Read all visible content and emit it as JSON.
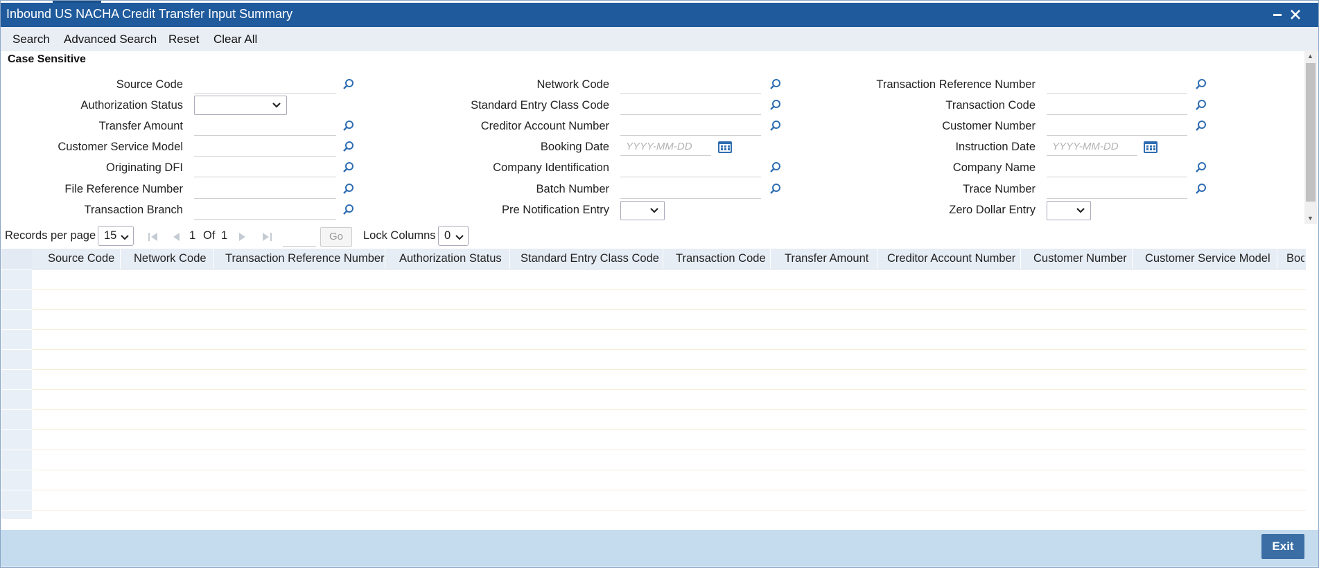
{
  "window": {
    "title": "Inbound US NACHA Credit Transfer Input Summary"
  },
  "menu": {
    "search": "Search",
    "advanced_search": "Advanced Search",
    "reset": "Reset",
    "clear_all": "Clear All"
  },
  "form": {
    "section_title": "Case Sensitive",
    "fields": {
      "source_code": "Source Code",
      "authorization_status": "Authorization Status",
      "transfer_amount": "Transfer Amount",
      "customer_service_model": "Customer Service Model",
      "originating_dfi": "Originating DFI",
      "file_reference_number": "File Reference Number",
      "transaction_branch": "Transaction Branch",
      "network_code": "Network Code",
      "standard_entry_class_code": "Standard Entry Class Code",
      "creditor_account_number": "Creditor Account Number",
      "booking_date": "Booking Date",
      "company_identification": "Company Identification",
      "batch_number": "Batch Number",
      "pre_notification_entry": "Pre Notification Entry",
      "transaction_reference_number": "Transaction Reference Number",
      "transaction_code": "Transaction Code",
      "customer_number": "Customer Number",
      "instruction_date": "Instruction Date",
      "company_name": "Company Name",
      "trace_number": "Trace Number",
      "zero_dollar_entry": "Zero Dollar Entry"
    },
    "date_placeholder": "YYYY-MM-DD"
  },
  "pager": {
    "records_per_page_label": "Records per page",
    "records_per_page_value": "15",
    "current_page": "1",
    "of_label": "Of",
    "total_pages": "1",
    "go_label": "Go",
    "lock_columns_label": "Lock Columns",
    "lock_columns_value": "0"
  },
  "grid": {
    "columns": [
      "Source Code",
      "Network Code",
      "Transaction Reference Number",
      "Authorization Status",
      "Standard Entry Class Code",
      "Transaction Code",
      "Transfer Amount",
      "Creditor Account Number",
      "Customer Number",
      "Customer Service Model",
      "Boo"
    ]
  },
  "footer": {
    "exit_label": "Exit"
  },
  "colors": {
    "title_bar": "#1f5a9c",
    "menu_bar": "#e9eef5",
    "footer": "#c4dced",
    "exit_button": "#3a6ea5",
    "icon": "#2f6db2"
  }
}
